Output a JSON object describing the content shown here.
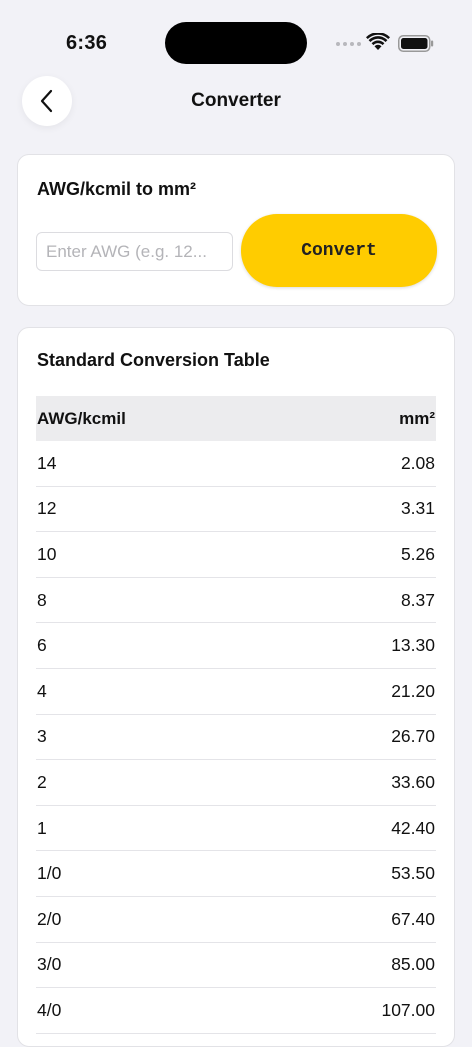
{
  "status_bar": {
    "time": "6:36"
  },
  "nav": {
    "title": "Converter",
    "back_icon": "chevron-left-icon"
  },
  "converter": {
    "title": "AWG/kcmil to mm²",
    "input_placeholder": "Enter AWG (e.g. 12...",
    "input_value": "",
    "button_label": "Convert",
    "accent_color": "#ffcc00"
  },
  "table": {
    "title": "Standard Conversion Table",
    "headers": [
      "AWG/kcmil",
      "mm²"
    ],
    "rows": [
      {
        "awg": "14",
        "mm2": "2.08"
      },
      {
        "awg": "12",
        "mm2": "3.31"
      },
      {
        "awg": "10",
        "mm2": "5.26"
      },
      {
        "awg": "8",
        "mm2": "8.37"
      },
      {
        "awg": "6",
        "mm2": "13.30"
      },
      {
        "awg": "4",
        "mm2": "21.20"
      },
      {
        "awg": "3",
        "mm2": "26.70"
      },
      {
        "awg": "2",
        "mm2": "33.60"
      },
      {
        "awg": "1",
        "mm2": "42.40"
      },
      {
        "awg": "1/0",
        "mm2": "53.50"
      },
      {
        "awg": "2/0",
        "mm2": "67.40"
      },
      {
        "awg": "3/0",
        "mm2": "85.00"
      },
      {
        "awg": "4/0",
        "mm2": "107.00"
      }
    ]
  }
}
